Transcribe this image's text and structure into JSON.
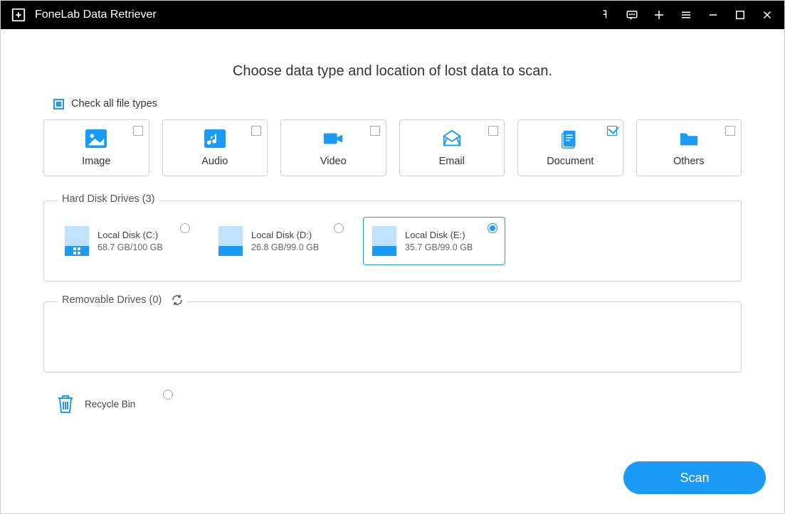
{
  "app": {
    "title": "FoneLab Data Retriever"
  },
  "main": {
    "heading": "Choose data type and location of lost data to scan.",
    "check_all_label": "Check all file types",
    "check_all_state": "partial",
    "types": [
      {
        "label": "Image",
        "checked": false
      },
      {
        "label": "Audio",
        "checked": false
      },
      {
        "label": "Video",
        "checked": false
      },
      {
        "label": "Email",
        "checked": false
      },
      {
        "label": "Document",
        "checked": true
      },
      {
        "label": "Others",
        "checked": false
      }
    ],
    "hard_drives_label": "Hard Disk Drives (3)",
    "hard_drives": [
      {
        "name": "Local Disk (C:)",
        "size": "68.7 GB/100 GB",
        "selected": false,
        "windows": true
      },
      {
        "name": "Local Disk (D:)",
        "size": "26.8 GB/99.0 GB",
        "selected": false,
        "windows": false
      },
      {
        "name": "Local Disk (E:)",
        "size": "35.7 GB/99.0 GB",
        "selected": true,
        "windows": false
      }
    ],
    "removable_label": "Removable Drives (0)",
    "recycle_label": "Recycle Bin",
    "scan_label": "Scan"
  }
}
